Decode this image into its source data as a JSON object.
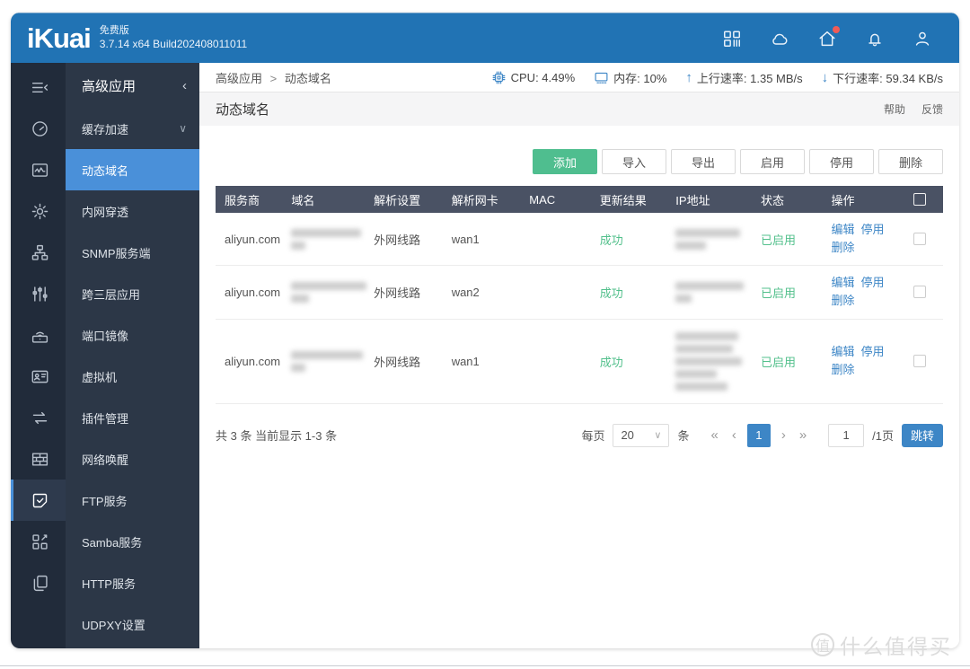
{
  "colors": {
    "topbar_blue": "#2173b4",
    "accent_blue": "#4a90d9",
    "link_blue": "#3d86c6",
    "button_green": "#4fbe8f",
    "status_green": "#53c08c",
    "table_header": "#4a5264",
    "rail_bg": "#212b3a",
    "panel_bg": "#2c3747",
    "badge_red": "#f05b56"
  },
  "topbar": {
    "logo": "iKuai",
    "edition": "免费版",
    "build": "3.7.14 x64 Build202408011011",
    "icons": [
      {
        "name": "apps-grid-icon",
        "badge": false
      },
      {
        "name": "cloud-icon",
        "badge": false
      },
      {
        "name": "home-icon",
        "badge": true
      },
      {
        "name": "bell-icon",
        "badge": false
      },
      {
        "name": "user-icon",
        "badge": false
      }
    ]
  },
  "sidebar": {
    "rail": [
      {
        "icon": "menu-collapse-icon",
        "active": false
      },
      {
        "icon": "gauge-icon",
        "active": false
      },
      {
        "icon": "monitor-chart-icon",
        "active": false
      },
      {
        "icon": "gear-icon",
        "active": false
      },
      {
        "icon": "topology-icon",
        "active": false
      },
      {
        "icon": "sliders-icon",
        "active": false
      },
      {
        "icon": "wireless-icon",
        "active": false
      },
      {
        "icon": "idcard-icon",
        "active": false
      },
      {
        "icon": "swap-arrows-icon",
        "active": false
      },
      {
        "icon": "firewall-icon",
        "active": false
      },
      {
        "icon": "note-check-icon",
        "active": true
      },
      {
        "icon": "plugin-grid-icon",
        "active": false
      },
      {
        "icon": "copy-pages-icon",
        "active": false
      }
    ],
    "header": {
      "label": "高级应用",
      "chevron": "‹"
    },
    "items": [
      {
        "label": "缓存加速",
        "selected": false,
        "chevron": "∨"
      },
      {
        "label": "动态域名",
        "selected": true,
        "chevron": ""
      },
      {
        "label": "内网穿透",
        "selected": false,
        "chevron": ""
      },
      {
        "label": "SNMP服务端",
        "selected": false,
        "chevron": ""
      },
      {
        "label": "跨三层应用",
        "selected": false,
        "chevron": ""
      },
      {
        "label": "端口镜像",
        "selected": false,
        "chevron": ""
      },
      {
        "label": "虚拟机",
        "selected": false,
        "chevron": ""
      },
      {
        "label": "插件管理",
        "selected": false,
        "chevron": ""
      },
      {
        "label": "网络唤醒",
        "selected": false,
        "chevron": ""
      },
      {
        "label": "FTP服务",
        "selected": false,
        "chevron": ""
      },
      {
        "label": "Samba服务",
        "selected": false,
        "chevron": ""
      },
      {
        "label": "HTTP服务",
        "selected": false,
        "chevron": ""
      },
      {
        "label": "UDPXY设置",
        "selected": false,
        "chevron": ""
      }
    ]
  },
  "statusbar": {
    "breadcrumb": {
      "parent": "高级应用",
      "separator": ">",
      "current": "动态域名"
    },
    "stats": [
      {
        "icon": "cpu-icon",
        "label": "CPU: 4.49%"
      },
      {
        "icon": "memory-icon",
        "label": "内存: 10%"
      },
      {
        "icon": "arrow-up",
        "glyph": "↑",
        "label": "上行速率: 1.35 MB/s"
      },
      {
        "icon": "arrow-down",
        "glyph": "↓",
        "label": "下行速率: 59.34 KB/s"
      }
    ]
  },
  "page": {
    "title": "动态域名",
    "help": "帮助",
    "feedback": "反馈"
  },
  "toolbar": {
    "buttons": [
      {
        "label": "添加",
        "style": "primary"
      },
      {
        "label": "导入",
        "style": "default"
      },
      {
        "label": "导出",
        "style": "default"
      },
      {
        "label": "启用",
        "style": "default"
      },
      {
        "label": "停用",
        "style": "default"
      },
      {
        "label": "删除",
        "style": "default"
      }
    ]
  },
  "table": {
    "columns": [
      "服务商",
      "域名",
      "解析设置",
      "解析网卡",
      "MAC",
      "更新结果",
      "IP地址",
      "状态",
      "操作"
    ],
    "rows": [
      {
        "provider": "aliyun.com",
        "domain_blur": [
          78,
          16
        ],
        "setting": "外网线路",
        "iface": "wan1",
        "mac": "",
        "result": "成功",
        "ip_blur": [
          72,
          34
        ],
        "status": "已启用",
        "actions": [
          "编辑",
          "停用",
          "删除"
        ]
      },
      {
        "provider": "aliyun.com",
        "domain_blur": [
          84,
          20
        ],
        "setting": "外网线路",
        "iface": "wan2",
        "mac": "",
        "result": "成功",
        "ip_blur": [
          76,
          18
        ],
        "status": "已启用",
        "actions": [
          "编辑",
          "停用",
          "删除"
        ]
      },
      {
        "provider": "aliyun.com",
        "domain_blur": [
          80,
          16
        ],
        "setting": "外网线路",
        "iface": "wan1",
        "mac": "",
        "result": "成功",
        "ip_blur": [
          70,
          64,
          74,
          46,
          58
        ],
        "status": "已启用",
        "actions": [
          "编辑",
          "停用",
          "删除"
        ]
      }
    ]
  },
  "footer": {
    "summary": "共 3 条 当前显示 1-3 条",
    "per_page_label": "每页",
    "per_page_value": "20",
    "unit": "条",
    "pager": {
      "first": "«",
      "prev": "‹",
      "current": "1",
      "next": "›",
      "last": "»"
    },
    "jump_value": "1",
    "jump_suffix": "/1页",
    "jump_button": "跳转"
  },
  "watermark": {
    "badge": "值",
    "text": "什么值得买"
  }
}
